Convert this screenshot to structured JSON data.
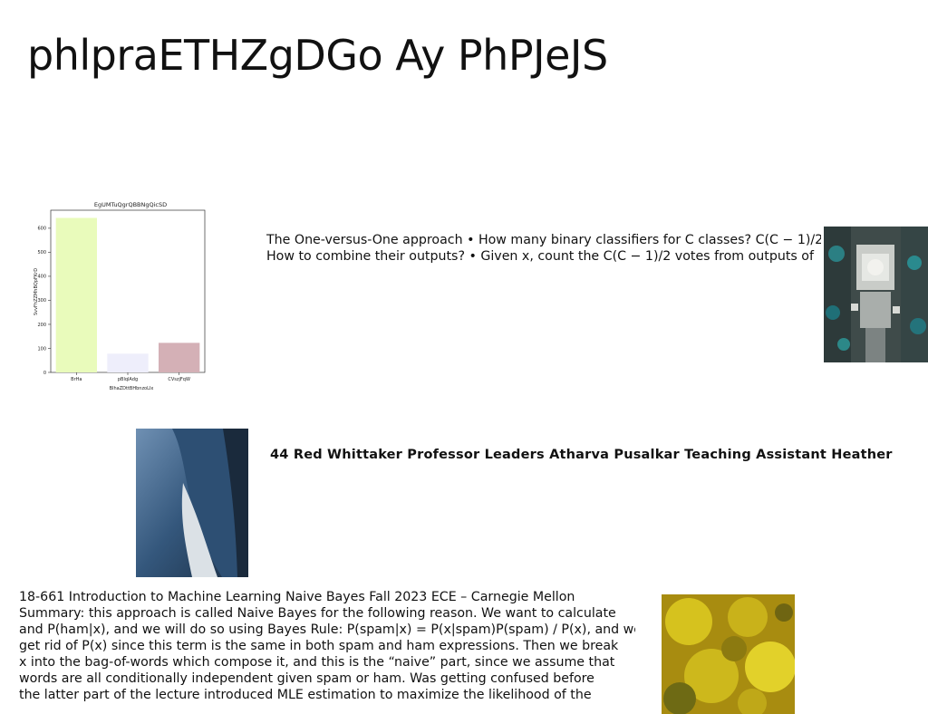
{
  "slide": {
    "title": "phlpraETHZgDGo Ay PhPJeJS",
    "ovo_text_lines": [
      "The One-versus-One approach • How many binary classifiers for C classes? C(C − 1)/2",
      "How to combine their outputs? • Given x, count the C(C − 1)/2 votes from outputs of"
    ],
    "staff_text": "44 Red Whittaker Professor Leaders Atharva Pusalkar Teaching Assistant Heather",
    "summary_lines": [
      "18-661 Introduction to Machine Learning Naive Bayes Fall 2023 ECE – Carnegie Mellon",
      "Summary: this approach is called Naive Bayes for the following reason. We want to calculate",
      "and P(ham|x), and we will do so using Bayes Rule: P(spam|x) = P(x|spam)P(spam) / P(x), and we",
      "get rid of P(x) since this term is the same in both spam and ham expressions. Then we break",
      "x into the bag-of-words which compose it, and this is the “naive” part, since we assume that",
      "words are all conditionally independent given spam or ham. Was getting confused before",
      "the latter part of the lecture introduced MLE estimation to maximize the likelihood of the"
    ],
    "photos": {
      "aerial": "aerial-city-photo",
      "blue": "blue-garment-photo",
      "yellow": "yellow-texture-photo"
    }
  },
  "chart_data": {
    "type": "bar",
    "title": "EgUMTuQgrQBBNgQicSD",
    "xlabel": "BlhaZDttBHbnzoLIx",
    "ylabel": "SvvFhZZMhBQpFKrD",
    "categories": [
      "BrHa",
      "pBlqlAdg",
      "CVszjFqW"
    ],
    "values": [
      643,
      78,
      123
    ],
    "colors": [
      "#e9fbbb",
      "#eeeefb",
      "#d4b0b6"
    ],
    "yticks": [
      0,
      100,
      200,
      300,
      400,
      500,
      600
    ],
    "ylim": [
      0,
      675
    ],
    "grid": false
  }
}
